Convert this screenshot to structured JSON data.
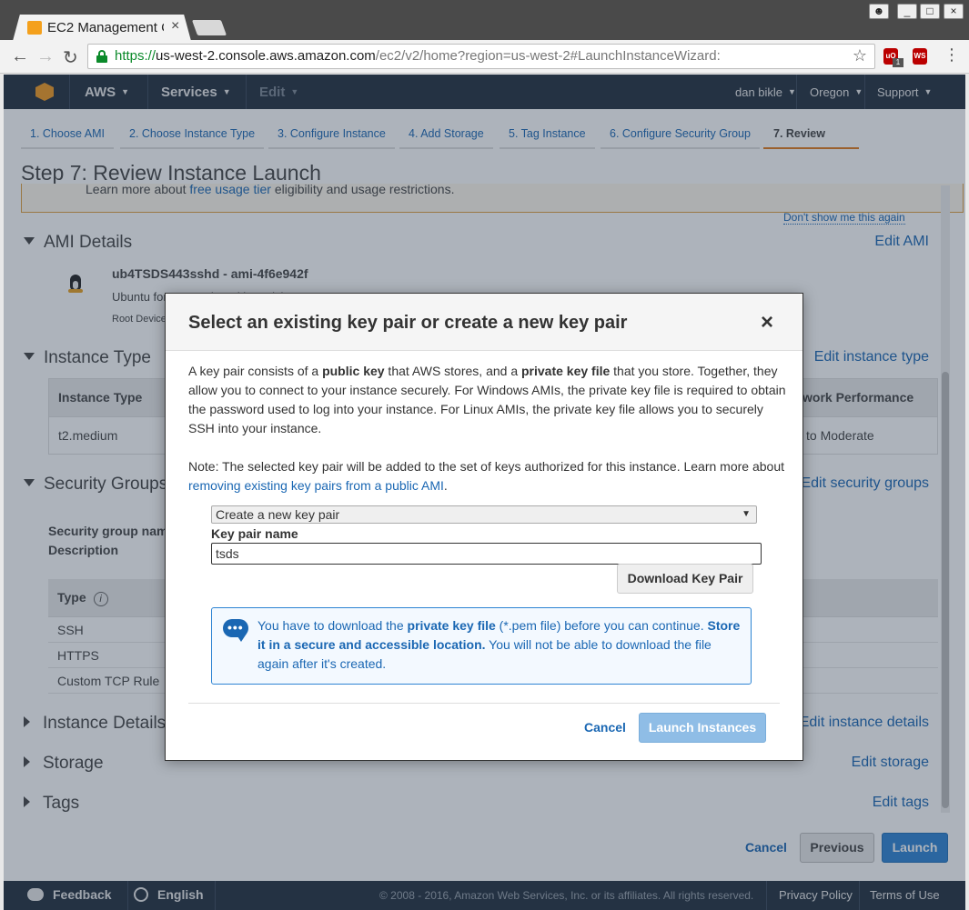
{
  "browser": {
    "tab_title": "EC2 Management C",
    "tab_close": "×",
    "url_scheme": "https://",
    "url_host": "us-west-2.console.aws.amazon.com",
    "url_path": "/ec2/v2/home?region=us-west-2#LaunchInstanceWizard:",
    "window_buttons": [
      "_",
      "□",
      "×"
    ],
    "extensions": [
      {
        "name": "ublock-icon",
        "label": "uO",
        "badge": "1"
      },
      {
        "name": "ws-shield-icon",
        "label": "WS"
      }
    ]
  },
  "aws_nav": {
    "brand": "AWS",
    "services": "Services",
    "edit": "Edit",
    "user": "dan bikle",
    "region": "Oregon",
    "support": "Support"
  },
  "steps": [
    {
      "label": "1. Choose AMI"
    },
    {
      "label": "2. Choose Instance Type"
    },
    {
      "label": "3. Configure Instance"
    },
    {
      "label": "4. Add Storage"
    },
    {
      "label": "5. Tag Instance"
    },
    {
      "label": "6. Configure Security Group"
    },
    {
      "label": "7. Review"
    }
  ],
  "page": {
    "title": "Step 7: Review Instance Launch",
    "free_tier_prefix": "Learn more about",
    "free_tier_link": "free usage tier",
    "free_tier_suffix": "eligibility and usage restrictions.",
    "dont_show": "Don't show me this again"
  },
  "ami": {
    "heading": "AMI Details",
    "edit": "Edit AMI",
    "name": "ub4TSDS443sshd - ami-4f6e942f",
    "desc_visible": "Ubuntu for TSDS cloned by quick-start AMI",
    "root_visible": "Root Device"
  },
  "instance_type": {
    "heading": "Instance Type",
    "edit": "Edit instance type",
    "col_type": "Instance Type",
    "col_network": "work Performance",
    "type_value": "t2.medium",
    "network_value": "to Moderate"
  },
  "security_groups": {
    "heading": "Security Groups",
    "edit": "Edit security groups",
    "name_label": "Security group nam",
    "desc_label": "Description",
    "col_type": "Type",
    "info": "i",
    "rows": [
      "SSH",
      "HTTPS",
      "Custom TCP Rule"
    ]
  },
  "instance_details": {
    "heading": "Instance Details",
    "edit": "Edit instance details"
  },
  "storage": {
    "heading": "Storage",
    "edit": "Edit storage"
  },
  "tags": {
    "heading": "Tags",
    "edit": "Edit tags"
  },
  "bottom": {
    "cancel": "Cancel",
    "previous": "Previous",
    "launch": "Launch"
  },
  "footer": {
    "feedback": "Feedback",
    "english": "English",
    "copyright": "© 2008 - 2016, Amazon Web Services, Inc. or its affiliates. All rights reserved.",
    "privacy": "Privacy Policy",
    "terms": "Terms of Use"
  },
  "modal": {
    "title": "Select an existing key pair or create a new key pair",
    "close": "×",
    "p1_a": "A key pair consists of a ",
    "p1_b": "public key",
    "p1_c": " that AWS stores, and a ",
    "p1_d": "private key file",
    "p1_e": " that you store. Together, they allow you to connect to your instance securely. For Windows AMIs, the private key file is required to obtain the password used to log into your instance. For Linux AMIs, the private key file allows you to securely SSH into your instance.",
    "p2_a": "Note: The selected key pair will be added to the set of keys authorized for this instance. Learn more about ",
    "p2_link": "removing existing key pairs from a public AMI",
    "p2_c": ".",
    "select_value": "Create a new key pair",
    "key_label": "Key pair name",
    "key_value": "tsds",
    "download": "Download Key Pair",
    "info_a": "You have to download the ",
    "info_b": "private key file",
    "info_c": " (*.pem file) before you can continue. ",
    "info_d": "Store it in a secure and accessible location.",
    "info_e": " You will not be able to download the file again after it's created.",
    "cancel": "Cancel",
    "launch": "Launch Instances"
  },
  "colors": {
    "aws_nav_bg": "#232f3e",
    "link_blue": "#1a67b3",
    "primary_button": "#2e84d3",
    "active_step_underline": "#e07a1a"
  }
}
